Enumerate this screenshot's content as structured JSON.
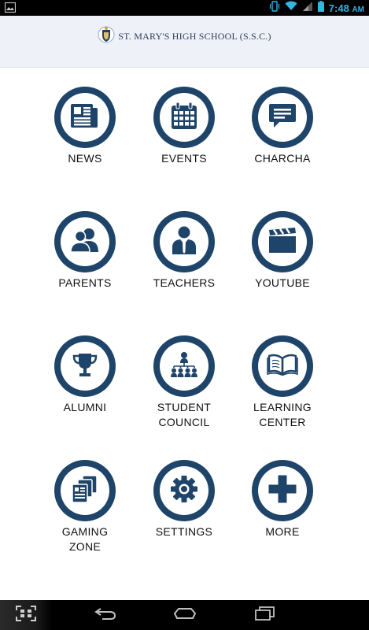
{
  "status_bar": {
    "time": "7:48",
    "ampm": "AM",
    "icons": [
      "image-icon",
      "vibrate-icon",
      "wifi-icon",
      "signal-icon",
      "battery-icon"
    ]
  },
  "header": {
    "school_name": "ST. MARY'S HIGH SCHOOL (S.S.C.)",
    "logo_icon": "school-crest-icon"
  },
  "menu": {
    "items": [
      {
        "label": "NEWS",
        "icon": "newspaper-icon"
      },
      {
        "label": "EVENTS",
        "icon": "calendar-icon"
      },
      {
        "label": "CHARCHA",
        "icon": "chat-bubble-icon"
      },
      {
        "label": "PARENTS",
        "icon": "people-icon"
      },
      {
        "label": "TEACHERS",
        "icon": "teacher-icon"
      },
      {
        "label": "YOUTUBE",
        "icon": "clapperboard-icon"
      },
      {
        "label": "ALUMNI",
        "icon": "trophy-icon"
      },
      {
        "label": "STUDENT\nCOUNCIL",
        "icon": "hierarchy-icon"
      },
      {
        "label": "LEARNING\nCENTER",
        "icon": "open-book-icon"
      },
      {
        "label": "GAMING\nZONE",
        "icon": "documents-icon"
      },
      {
        "label": "SETTINGS",
        "icon": "gear-icon"
      },
      {
        "label": "MORE",
        "icon": "plus-icon"
      }
    ]
  },
  "nav_bar": {
    "buttons": [
      "scan-icon",
      "back-icon",
      "home-icon",
      "recents-icon"
    ]
  },
  "colors": {
    "ring": "#1e4569",
    "icon": "#1e4569",
    "header_bg": "#eef1f8",
    "status_accent": "#33b5e5"
  }
}
